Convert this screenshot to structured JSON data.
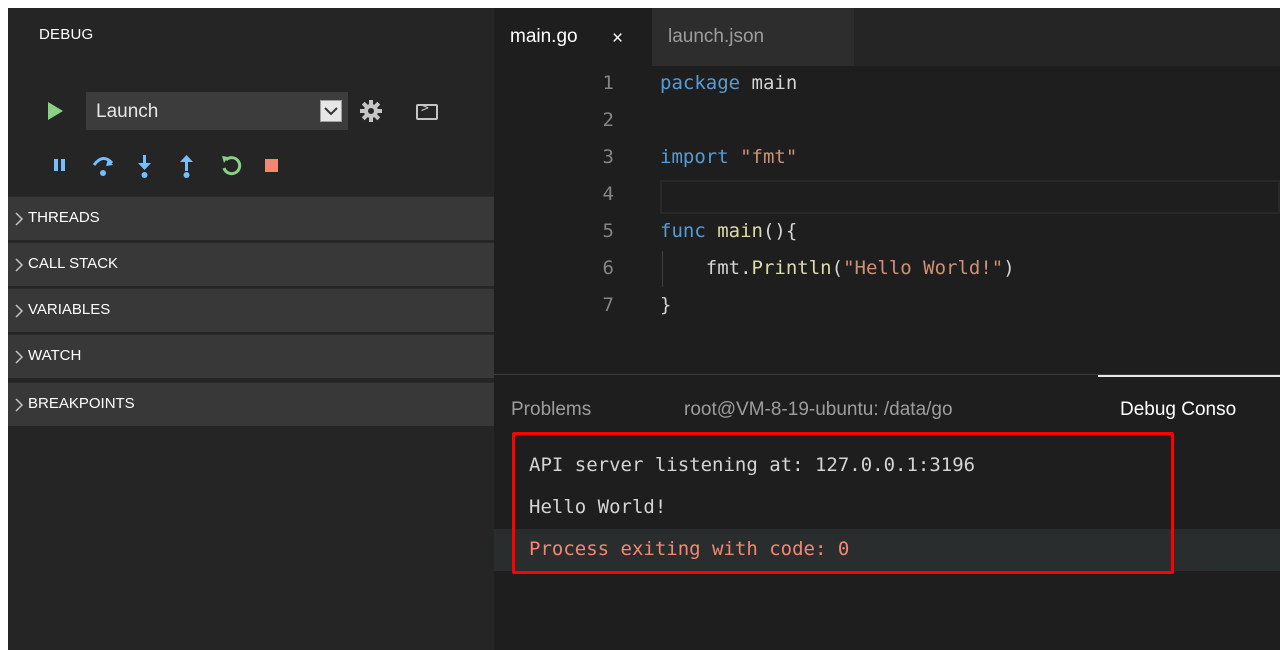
{
  "sidebar": {
    "title": "DEBUG",
    "config": {
      "selected": "Launch"
    },
    "sections": [
      {
        "label": "THREADS"
      },
      {
        "label": "CALL STACK"
      },
      {
        "label": "VARIABLES"
      },
      {
        "label": "WATCH"
      },
      {
        "label": "BREAKPOINTS"
      }
    ],
    "toolbar_icons": [
      "pause-icon",
      "step-over-icon",
      "step-into-icon",
      "step-out-icon",
      "restart-icon",
      "stop-icon"
    ]
  },
  "editor": {
    "tabs": [
      {
        "label": "main.go",
        "active": true,
        "close": "×"
      },
      {
        "label": "launch.json",
        "active": false
      }
    ],
    "lines": [
      {
        "num": "1",
        "text": "package main"
      },
      {
        "num": "2",
        "text": ""
      },
      {
        "num": "3",
        "text": "import \"fmt\""
      },
      {
        "num": "4",
        "text": ""
      },
      {
        "num": "5",
        "text": "func main(){"
      },
      {
        "num": "6",
        "text": "    fmt.Println(\"Hello World!\")"
      },
      {
        "num": "7",
        "text": "}"
      }
    ],
    "tokens": {
      "package": "package",
      "main": "main",
      "import": "import",
      "fmt_str": "\"fmt\"",
      "func": "func",
      "main_fn": "main",
      "paren_open": "(){",
      "indent_fmt": "fmt.",
      "println": "Println",
      "paren_l": "(",
      "hello_str": "\"Hello World!\"",
      "paren_r": ")",
      "close_brace": "}"
    }
  },
  "panel": {
    "tabs": [
      {
        "label": "Problems",
        "active": false
      },
      {
        "label": "root@VM-8-19-ubuntu: /data/go",
        "active": false
      },
      {
        "label": "Debug Conso",
        "active": true
      }
    ],
    "output": [
      {
        "text": "API server listening at: 127.0.0.1:3196",
        "color": "#d4d4d4"
      },
      {
        "text": "Hello World!",
        "color": "#d4d4d4"
      },
      {
        "text": "Process exiting with code: 0",
        "color": "#f48771"
      }
    ]
  },
  "colors": {
    "annotation": "#ff0000",
    "play": "#89d185",
    "debug_blue": "#75beff",
    "restart": "#89d185",
    "stop": "#f48771"
  }
}
